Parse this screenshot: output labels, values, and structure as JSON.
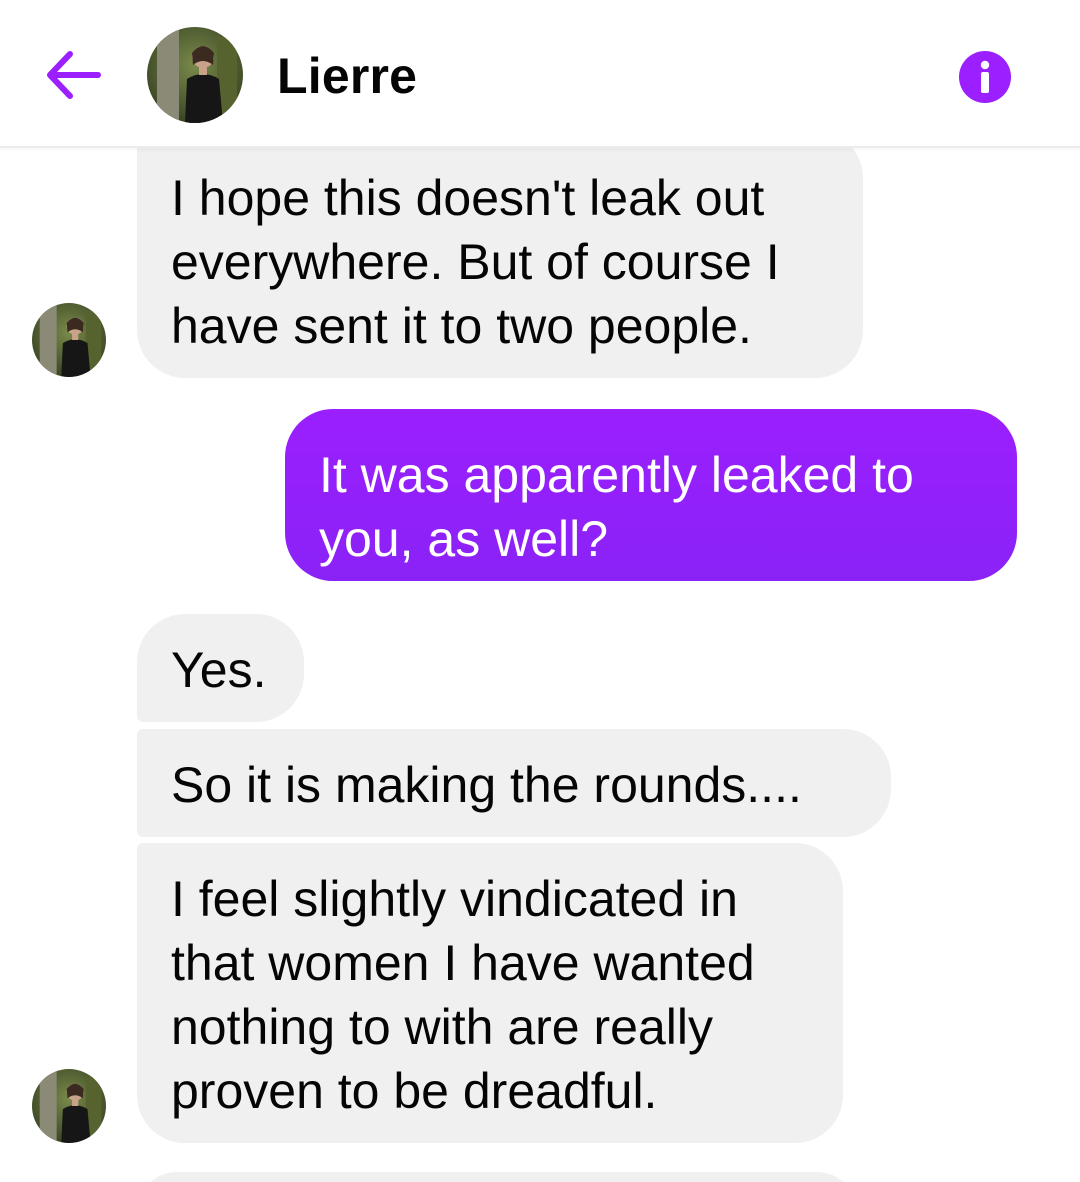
{
  "header": {
    "contact_name": "Lierre",
    "back_icon": "arrow-left-icon",
    "info_icon": "info-icon",
    "accent_color": "#9b1fff"
  },
  "messages": [
    {
      "direction": "received",
      "lines": [
        "I hope this doesn't leak out",
        "everywhere. But of course I",
        "have sent it to two people."
      ]
    },
    {
      "direction": "sent",
      "lines": [
        "It was apparently leaked to",
        "you, as well?"
      ]
    },
    {
      "direction": "received",
      "lines": [
        "Yes."
      ]
    },
    {
      "direction": "received",
      "lines": [
        "So it is making the rounds...."
      ]
    },
    {
      "direction": "received",
      "lines": [
        "I feel slightly vindicated in",
        "that women I have wanted",
        "nothing to with are really",
        "proven to be dreadful."
      ]
    }
  ],
  "colors": {
    "received_bubble": "#f0f0f0",
    "sent_bubble": "#8a22f6",
    "text": "#050505"
  }
}
